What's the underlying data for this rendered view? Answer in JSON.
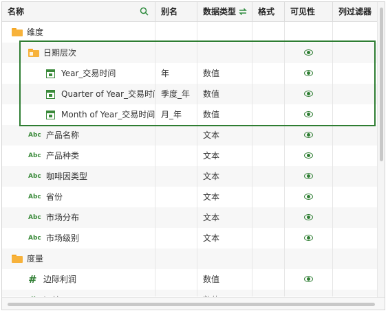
{
  "header": {
    "columns": [
      "名称",
      "别名",
      "数据类型",
      "格式",
      "可见性",
      "列过滤器"
    ],
    "search_icon": "search-icon",
    "swap_icon": "swap-icon"
  },
  "rows": [
    {
      "kind": "folder",
      "level": 0,
      "name": "维度",
      "alias": "",
      "type": "",
      "visible": false
    },
    {
      "kind": "hierarchy",
      "level": 1,
      "name": "日期层次",
      "alias": "",
      "type": "",
      "visible": true
    },
    {
      "kind": "date",
      "level": 2,
      "name": "Year_交易时间",
      "alias": "年",
      "type": "数值",
      "visible": true
    },
    {
      "kind": "date",
      "level": 2,
      "name": "Quarter of Year_交易时间",
      "alias": "季度_年",
      "type": "数值",
      "visible": true
    },
    {
      "kind": "date",
      "level": 2,
      "name": "Month of Year_交易时间",
      "alias": "月_年",
      "type": "数值",
      "visible": true
    },
    {
      "kind": "text",
      "level": 1,
      "name": "产品名称",
      "alias": "",
      "type": "文本",
      "visible": true
    },
    {
      "kind": "text",
      "level": 1,
      "name": "产品种类",
      "alias": "",
      "type": "文本",
      "visible": true
    },
    {
      "kind": "text",
      "level": 1,
      "name": "咖啡因类型",
      "alias": "",
      "type": "文本",
      "visible": true
    },
    {
      "kind": "text",
      "level": 1,
      "name": "省份",
      "alias": "",
      "type": "文本",
      "visible": true
    },
    {
      "kind": "text",
      "level": 1,
      "name": "市场分布",
      "alias": "",
      "type": "文本",
      "visible": true
    },
    {
      "kind": "text",
      "level": 1,
      "name": "市场级别",
      "alias": "",
      "type": "文本",
      "visible": true
    },
    {
      "kind": "folder",
      "level": 0,
      "name": "度量",
      "alias": "",
      "type": "",
      "visible": false
    },
    {
      "kind": "number",
      "level": 1,
      "name": "边际利润",
      "alias": "",
      "type": "数值",
      "visible": true
    },
    {
      "kind": "number",
      "level": 1,
      "name": "订单ID",
      "alias": "",
      "type": "数值",
      "visible": true
    }
  ],
  "abc_label": "Abc",
  "hash_label": "#",
  "colors": {
    "accent": "#2e7d32",
    "folder": "#f7b23b",
    "highlight": "#2e7d32"
  }
}
